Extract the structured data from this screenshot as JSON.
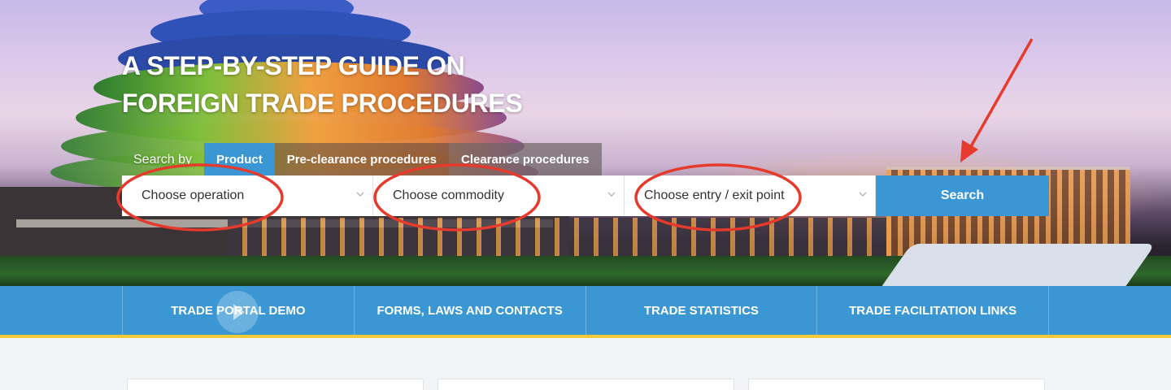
{
  "hero": {
    "title_line1": "A STEP-BY-STEP GUIDE ON",
    "title_line2": "FOREIGN TRADE PROCEDURES"
  },
  "search": {
    "search_by_label": "Search by",
    "tabs": [
      {
        "label": "Product",
        "active": true
      },
      {
        "label": "Pre-clearance procedures",
        "active": false
      },
      {
        "label": "Clearance procedures",
        "active": false
      }
    ],
    "selects": [
      {
        "value": "Choose operation"
      },
      {
        "value": "Choose commodity"
      },
      {
        "value": "Choose entry / exit point"
      }
    ],
    "button_label": "Search"
  },
  "nav": {
    "items": [
      {
        "label": "TRADE PORTAL DEMO"
      },
      {
        "label": "FORMS, LAWS AND CONTACTS"
      },
      {
        "label": "TRADE STATISTICS"
      },
      {
        "label": "TRADE FACILITATION LINKS"
      }
    ]
  },
  "colors": {
    "primary_blue": "#3a97d4",
    "accent_yellow": "#f2c936",
    "annotation_red": "#e53a2c"
  },
  "icons": [
    "chevron-down-icon",
    "play-icon",
    "annotation-arrow-icon"
  ]
}
